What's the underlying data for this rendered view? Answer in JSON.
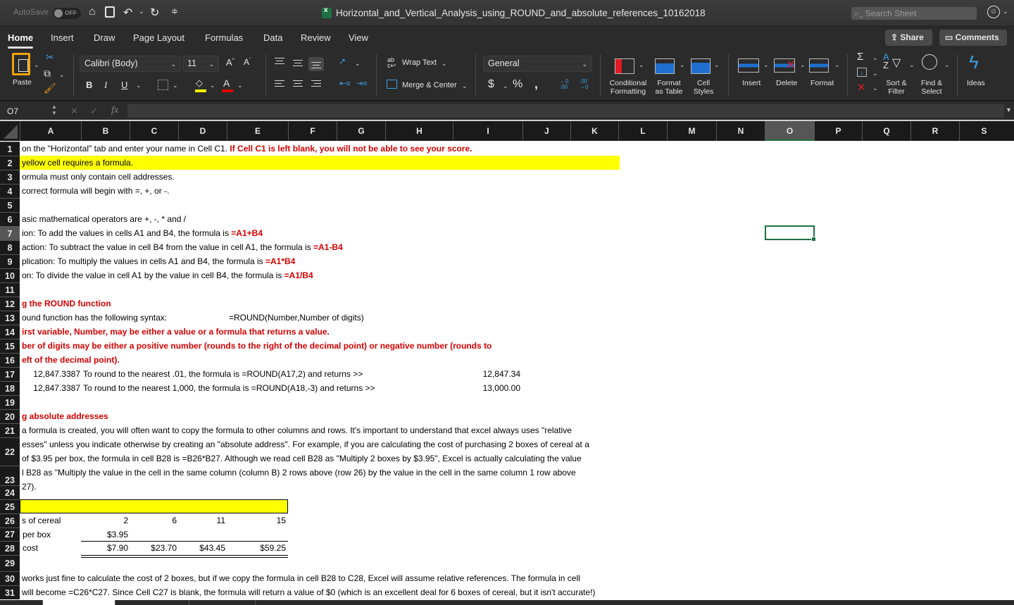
{
  "titlebar": {
    "autosave_label": "AutoSave",
    "autosave_state": "OFF",
    "document_title": "Horizontal_and_Vertical_Analysis_using_ROUND_and_absolute_references_10162018",
    "search_placeholder": "Search Sheet",
    "qat_icons": [
      "home-icon",
      "save-icon",
      "undo-icon",
      "redo-icon",
      "customize-icon"
    ]
  },
  "ribbon_tabs": [
    "Home",
    "Insert",
    "Draw",
    "Page Layout",
    "Formulas",
    "Data",
    "Review",
    "View"
  ],
  "active_tab": "Home",
  "share_label": "Share",
  "comments_label": "Comments",
  "ribbon": {
    "paste_label": "Paste",
    "font_name": "Calibri (Body)",
    "font_size": "11",
    "wrap_text_label": "Wrap Text",
    "merge_center_label": "Merge & Center",
    "number_format": "General",
    "conditional_formatting_label": [
      "Conditional",
      "Formatting"
    ],
    "format_as_table_label": [
      "Format",
      "as Table"
    ],
    "cell_styles_label": [
      "Cell",
      "Styles"
    ],
    "insert_label": "Insert",
    "delete_label": "Delete",
    "format_label": "Format",
    "sort_filter_label": [
      "Sort &",
      "Filter"
    ],
    "find_select_label": [
      "Find &",
      "Select"
    ],
    "ideas_label": "Ideas",
    "fill_color": "#ffff00",
    "font_color": "#e00000"
  },
  "formula_bar": {
    "name_box": "O7",
    "formula": ""
  },
  "columns": [
    "A",
    "B",
    "C",
    "D",
    "E",
    "F",
    "G",
    "H",
    "I",
    "J",
    "K",
    "L",
    "M",
    "N",
    "O",
    "P",
    "Q",
    "R",
    "S"
  ],
  "selected_column": "O",
  "selected_row": "7",
  "rows": [
    "1",
    "2",
    "3",
    "4",
    "5",
    "6",
    "7",
    "8",
    "9",
    "10",
    "11",
    "12",
    "13",
    "14",
    "15",
    "16",
    "17",
    "18",
    "19",
    "20",
    "21",
    "22",
    "23",
    "24",
    "25",
    "26",
    "27",
    "28",
    "29",
    "30",
    "31"
  ],
  "cells": {
    "r1_text": "on the \"Horizontal\" tab and enter your name in Cell C1.  ",
    "r1_red": "If Cell C1 is left blank, you will not be able to see your score.",
    "r2": "yellow cell requires a formula.",
    "r3": "ormula must only contain cell addresses.",
    "r4": "correct formula will begin with =, +, or -.",
    "r6": "asic mathematical operators are +, -, * and /",
    "r7_text": "ion:  To add the values in cells A1 and B4, the formula is ",
    "r7_red": "=A1+B4",
    "r8_text": "action:  To subtract the value in cell B4 from the value in cell A1, the formula is ",
    "r8_red": "=A1-B4",
    "r9_text": "plication:  To multiply the values in cells A1 and B4, the formula is ",
    "r9_red": "=A1*B4",
    "r10_text": "on:  To divide the value in cell A1 by the value in cell B4, the formula is ",
    "r10_red": "=A1/B4",
    "r12": "g the ROUND function",
    "r13_a": "ound function has the following syntax:",
    "r13_e": "=ROUND(Number,Number of digits)",
    "r14": "irst variable, Number, may be either a value or a formula that returns a value.",
    "r15": "ber of digits may be either a positive number (rounds to the right of the decimal point) or negative number (rounds to",
    "r16": "eft of the decimal point).",
    "r17_a": "12,847.3387",
    "r17_b": "To round to the nearest .01, the formula is =ROUND(A17,2) and returns >>",
    "r17_i": "12,847.34",
    "r18_a": "12,847.3387",
    "r18_b": "To round to the nearest 1,000, the formula is =ROUND(A18,-3) and returns >>",
    "r18_i": "13,000.00",
    "r20": "g absolute addresses",
    "r21": "a formula is created, you will often want to copy the formula to other columns and rows.  It's important to understand that excel always uses \"relative",
    "r22_l1": "esses\" unless you indicate otherwise by creating an \"absolute address\".  For example, if you are calculating the cost of purchasing 2 boxes of cereal at a",
    "r22_l2": "of $3.95 per box, the formula in cell B28 is =B26*B27.  Although we read cell B28  as \"Multiply 2 boxes by $3.95\", Excel is actually calculating the value",
    "r23_l1": "l B28 as \"Multiply the value in the cell in the same column (column B) 2 rows above (row 26) by the value in the cell in the same column 1 row above",
    "r23_l2": "27).",
    "r26_a": "s of cereal",
    "r26_vals": [
      "2",
      "6",
      "11",
      "15"
    ],
    "r27_a": "per box",
    "r27_b": "$3.95",
    "r28_a": "cost",
    "r28_vals": [
      "$7.90",
      "$23.70",
      "$43.45",
      "$59.25"
    ],
    "r30": "works just fine to calculate the cost of 2 boxes, but if we copy the formula in cell B28 to C28, Excel will assume relative references.   The formula in cell",
    "r31": "will become =C26*C27.  Since Cell C27 is blank, the formula will return a value of $0 (which is an excellent deal for 6 boxes of cereal, but it isn't accurate!)"
  }
}
